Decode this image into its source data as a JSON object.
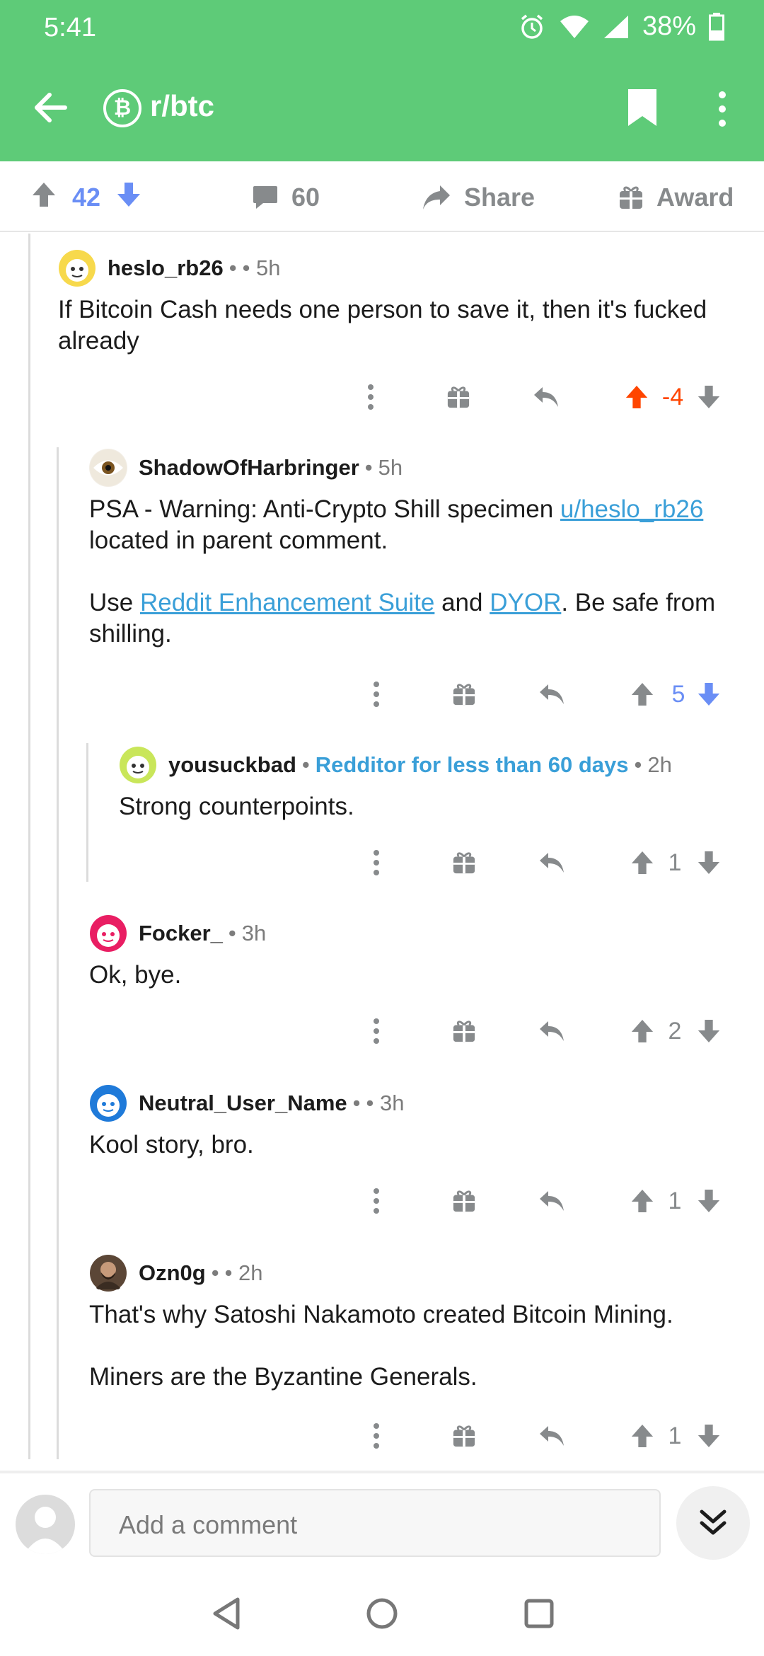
{
  "status_bar": {
    "time": "5:41",
    "battery": "38%"
  },
  "header": {
    "subreddit": "r/btc",
    "subreddit_icon": "₿"
  },
  "post_bar": {
    "score": "42",
    "comments": "60",
    "share": "Share",
    "award": "Award"
  },
  "comments": [
    {
      "author": "heslo_rb26",
      "separator": "•",
      "time": "• 5h",
      "body": [
        "If Bitcoin Cash needs one person to save it, then it's fucked already"
      ],
      "score": "-4",
      "upvoted": true
    },
    {
      "author": "ShadowOfHarbringer",
      "separator": "•",
      "time": "5h",
      "body_p1_text": "PSA - Warning: Anti-Crypto Shill specimen ",
      "body_p1_link": "u/heslo_rb26",
      "body_p1_tail": " located in parent comment.",
      "body_p2_a": "Use ",
      "body_p2_link1": "Reddit Enhancement Suite",
      "body_p2_b": " and ",
      "body_p2_link2": "DYOR",
      "body_p2_c": ". Be safe from shilling.",
      "score": "5",
      "downvoted": true
    },
    {
      "author": "yousuckbad",
      "separator": "•",
      "flair": "Redditor for less than 60 days",
      "time": "2h",
      "body": [
        "Strong counterpoints."
      ],
      "score": "1"
    },
    {
      "author": "Focker_",
      "separator": "•",
      "time": "3h",
      "body": [
        "Ok, bye."
      ],
      "score": "2"
    },
    {
      "author": "Neutral_User_Name",
      "separator": "•",
      "time": "• 3h",
      "body": [
        "Kool story, bro."
      ],
      "score": "1"
    },
    {
      "author": "Ozn0g",
      "separator": "•",
      "time": "• 2h",
      "body": [
        "That's why Satoshi Nakamoto created Bitcoin Mining.",
        "Miners are the Byzantine Generals."
      ],
      "score": "1"
    }
  ],
  "composer": {
    "placeholder": "Add a comment"
  },
  "colors": {
    "header_green": "#5ecb78",
    "upvote_orange": "#ff4500",
    "downvote_blue": "#6a8ef5",
    "link_blue": "#3a9fd8"
  }
}
